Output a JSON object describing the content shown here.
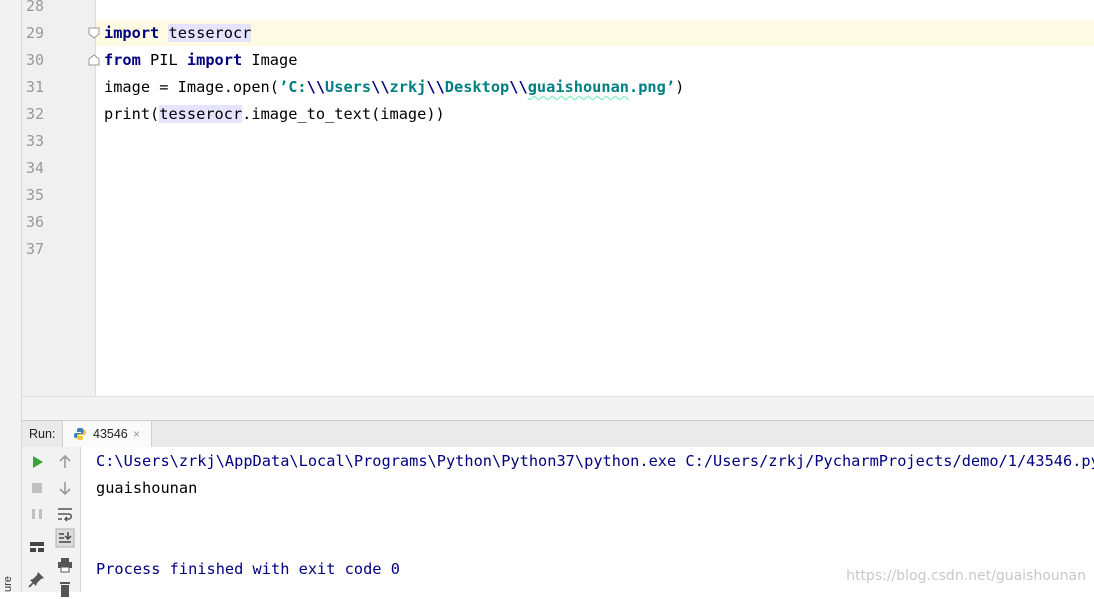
{
  "sidebar": {
    "label": "ure"
  },
  "editor": {
    "line_numbers": [
      "28",
      "29",
      "30",
      "31",
      "32",
      "33",
      "34",
      "35",
      "36",
      "37"
    ],
    "code": {
      "l29_kw": "import",
      "l29_mod": "tesserocr",
      "l30_from": "from",
      "l30_mid": " PIL ",
      "l30_import": "import",
      "l30_end": " Image",
      "l31_pre": "image = Image.open(",
      "l31_q1": "’",
      "l31_s1": "C:",
      "l31_e1": "\\\\",
      "l31_s2": "Users",
      "l31_e2": "\\\\",
      "l31_s3": "zrkj",
      "l31_e3": "\\\\",
      "l31_s4": "Desktop",
      "l31_e4": "\\\\",
      "l31_s5": "guaishounan",
      "l31_s6": ".png",
      "l31_q2": "’",
      "l31_post": ")",
      "l32_pre": "print(",
      "l32_mod": "tesserocr",
      "l32_post": ".image_to_text(image))"
    }
  },
  "run": {
    "label": "Run:",
    "tab_label": "43546",
    "tab_close": "×"
  },
  "console": {
    "command": "C:\\Users\\zrkj\\AppData\\Local\\Programs\\Python\\Python37\\python.exe C:/Users/zrkj/PycharmProjects/demo/1/43546.py",
    "output": "guaishounan",
    "exit": "Process finished with exit code 0"
  },
  "watermark": "https://blog.csdn.net/guaishounan",
  "colors": {
    "keyword": "#000080",
    "string": "#008080",
    "current_line": "#fffae3",
    "run_green": "#3aa33a"
  }
}
